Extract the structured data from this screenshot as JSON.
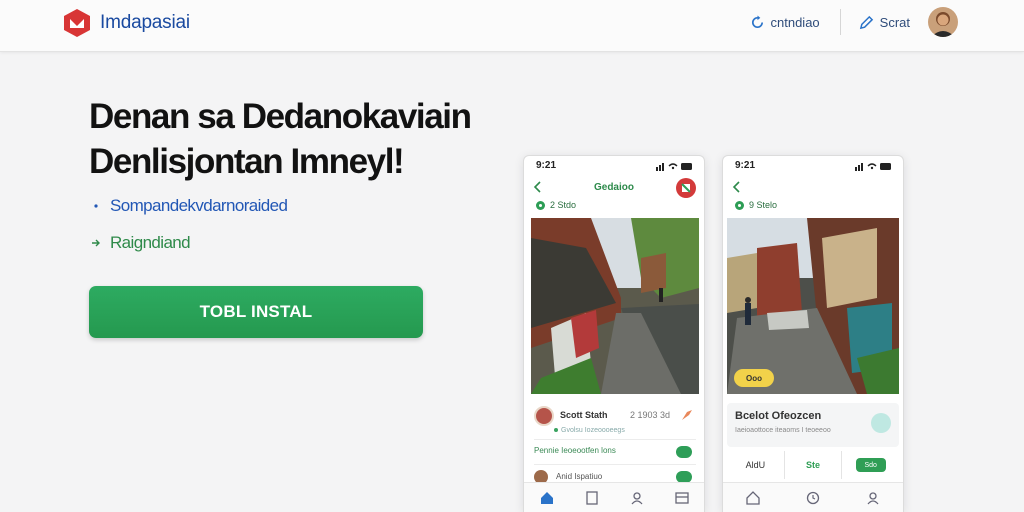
{
  "header": {
    "brand_name": "Imdapasiai",
    "link_1": "cntndiao",
    "link_2": "Scrat",
    "icons": [
      "brand-logo-icon",
      "refresh-icon",
      "pen-icon",
      "avatar"
    ]
  },
  "hero": {
    "title_line_1": "Denan sa Dedanokaviain",
    "title_line_2": "Denlisjontan Imneyl!",
    "feature_1": "Sompandekvdarnoraided",
    "feature_2": "Raigndiand",
    "install_button": "TOBL INSTAL"
  },
  "phones": [
    {
      "status_time": "9:21",
      "nav_title": "Gedaioo",
      "location": "2 Stdo",
      "post_name": "Scott Stath",
      "post_time": "2 1903  3d",
      "post_sub": "Gvolsu Iozeoooeegs",
      "comment": "Pennie Ieoeootfen lons",
      "author": "Anid  Ispatiuo"
    },
    {
      "status_time": "9:21",
      "location": "9 Stelo",
      "badge": "Ooo",
      "card_title": "Bcelot Ofeozcen",
      "card_sub": "Iaeioaottoce iteaoms I teoeeoo",
      "action_1": "AldU",
      "action_2": "Ste",
      "action_3": "Sdo"
    }
  ],
  "colors": {
    "brand_red": "#d83535",
    "brand_blue": "#1a4aa0",
    "accent_green": "#25994f"
  }
}
